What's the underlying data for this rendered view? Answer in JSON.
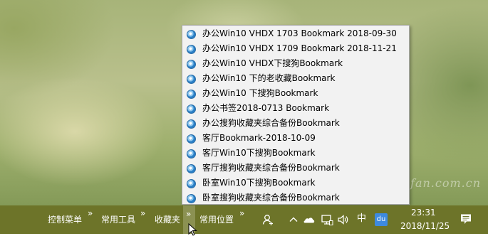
{
  "bookmark_menu": {
    "items": [
      {
        "label": "办公Win10 VHDX 1703 Bookmark 2018-09-30"
      },
      {
        "label": "办公Win10 VHDX 1709 Bookmark 2018-11-21"
      },
      {
        "label": "办公Win10 VHDX下搜狗Bookmark"
      },
      {
        "label": "办公Win10 下的老收藏Bookmark"
      },
      {
        "label": "办公Win10 下搜狗Bookmark"
      },
      {
        "label": "办公书签2018-0713 Bookmark"
      },
      {
        "label": "办公搜狗收藏夹综合备份Bookmark"
      },
      {
        "label": "客厅Bookmark-2018-10-09"
      },
      {
        "label": "客厅Win10下搜狗Bookmark"
      },
      {
        "label": "客厅搜狗收藏夹综合备份Bookmark"
      },
      {
        "label": "卧室Win10下搜狗Bookmark"
      },
      {
        "label": "卧室搜狗收藏夹综合备份Bookmark"
      }
    ]
  },
  "taskbar": {
    "toolbars": [
      {
        "label": "控制菜单",
        "chevron": "»"
      },
      {
        "label": "常用工具",
        "chevron": "»"
      },
      {
        "label": "收藏夹",
        "chevron": "»"
      },
      {
        "label": "常用位置",
        "chevron": "»"
      }
    ],
    "tray": {
      "icons": [
        "people-icon",
        "show-hidden-icons-chevron",
        "onedrive-cloud-icon",
        "network-icon",
        "volume-icon"
      ],
      "ime_label": "中",
      "baidu_label": "du"
    },
    "clock": {
      "time": "23:31",
      "date": "2018/11/25"
    }
  },
  "watermark": "www.cfan.com.cn",
  "colors": {
    "taskbar": "#6d7429",
    "menu_bg": "#f2f2f2",
    "active_chevron_bg": "#8b9152"
  }
}
